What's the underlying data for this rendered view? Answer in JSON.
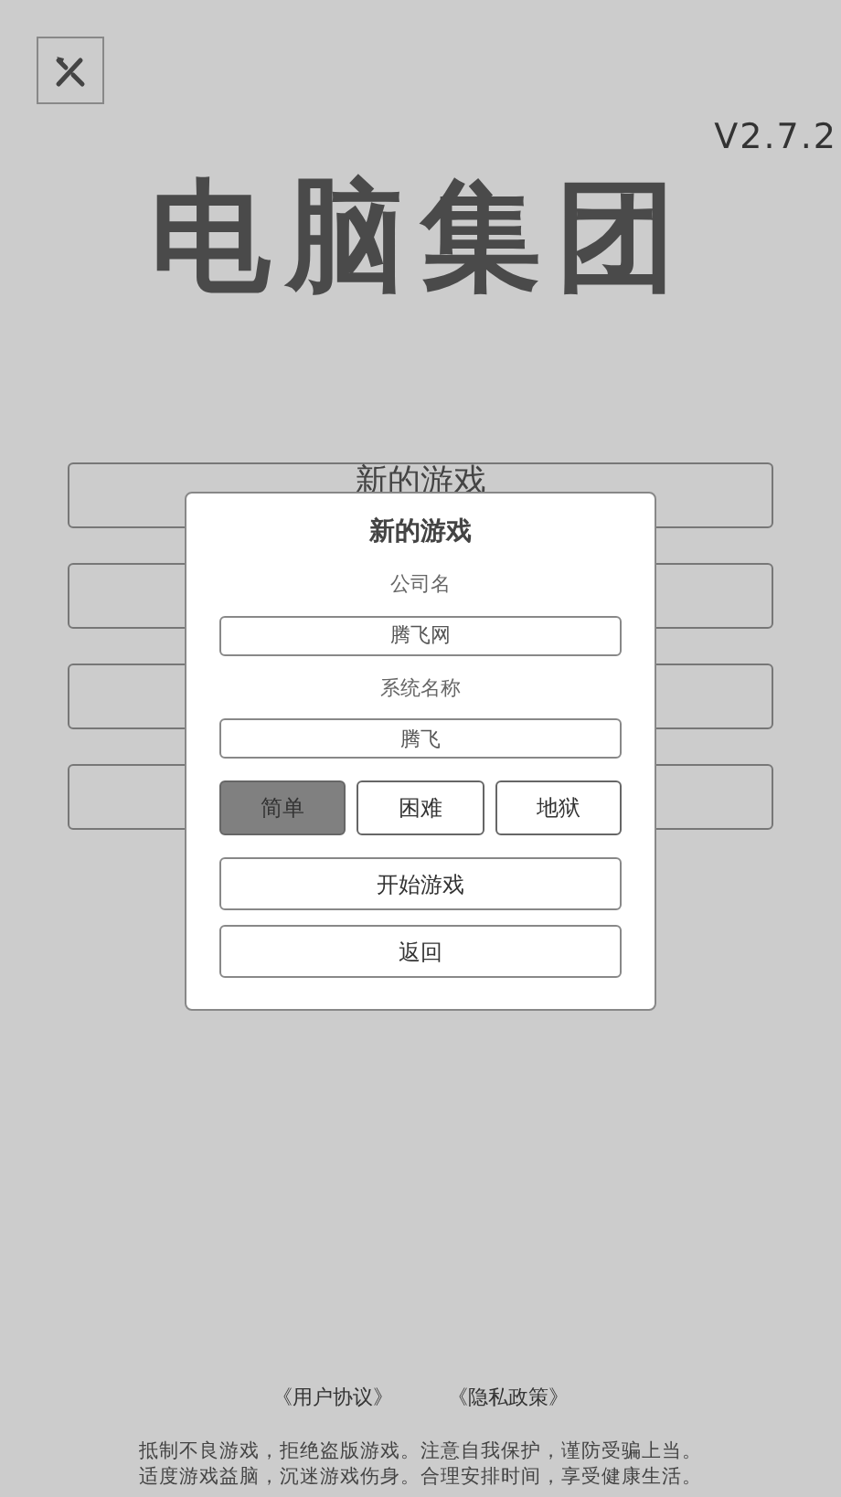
{
  "settings_button": {
    "kind": "button"
  },
  "version": "V2.7.2",
  "title": "电脑集团",
  "menu_buttons": [
    {
      "kind": "button",
      "label": "新的游戏"
    },
    {
      "kind": "button"
    },
    {
      "kind": "button"
    },
    {
      "kind": "button"
    }
  ],
  "dialog": {
    "title": "新的游戏",
    "fields": [
      {
        "label": "公司名",
        "value": "腾飞网"
      },
      {
        "label": "系统名称",
        "value": "腾飞"
      }
    ],
    "difficulties": [
      {
        "label": "简单",
        "selected": true
      },
      {
        "label": "困难",
        "selected": false
      },
      {
        "label": "地狱",
        "selected": false
      }
    ],
    "buttons": [
      "开始游戏",
      "返回"
    ]
  },
  "footer": {
    "links": [
      "《用户协议》",
      "《隐私政策》"
    ],
    "notice": [
      "抵制不良游戏，拒绝盗版游戏。注意自我保护，谨防受骗上当。",
      "适度游戏益脑，沉迷游戏伤身。合理安排时间，享受健康生活。"
    ]
  }
}
